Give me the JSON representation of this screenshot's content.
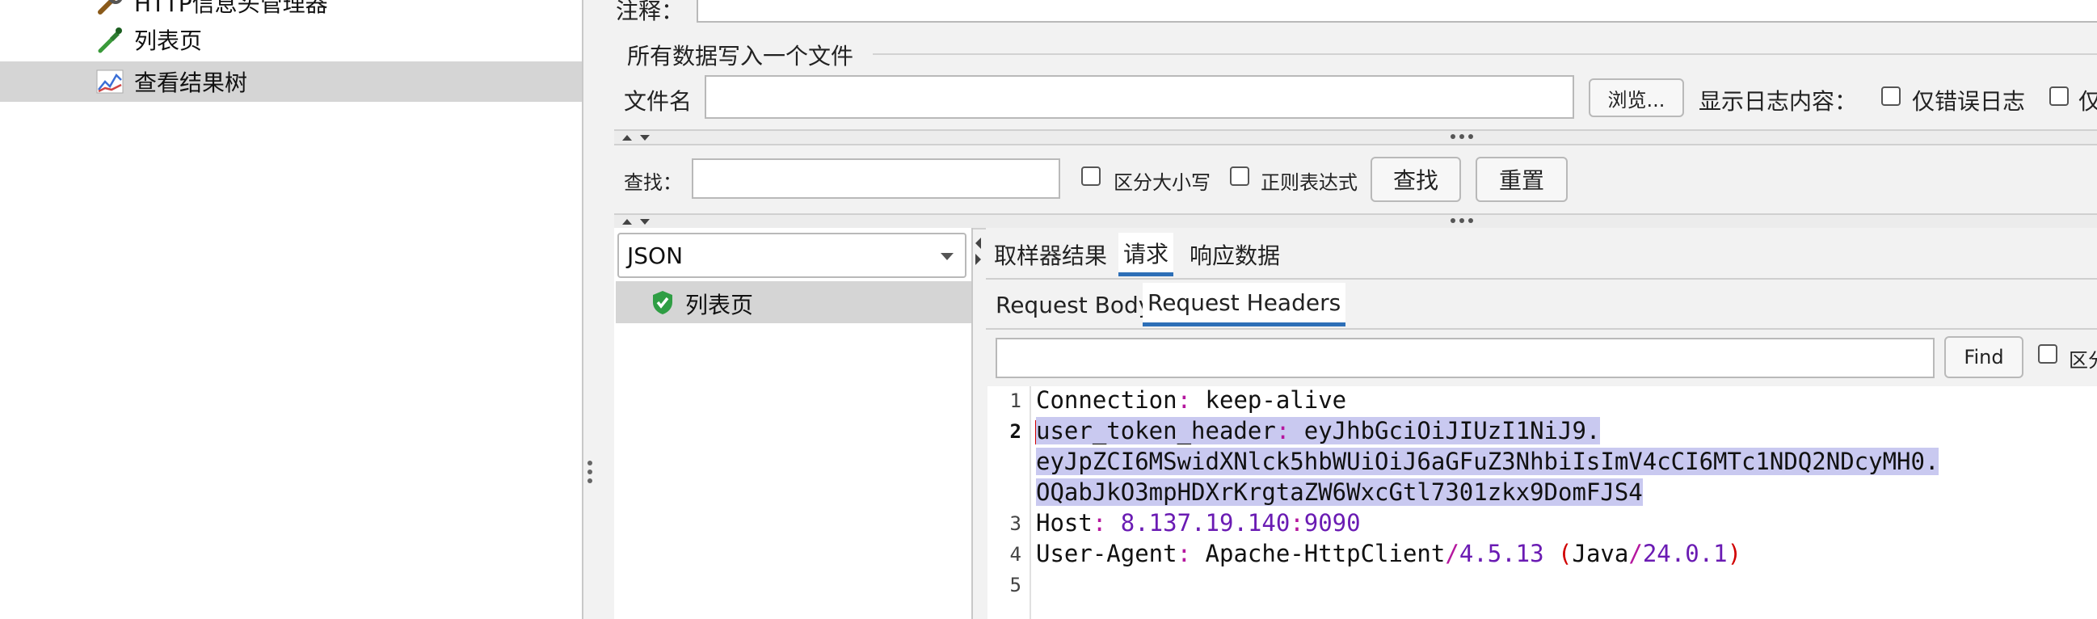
{
  "tree": {
    "items": [
      {
        "label": "HTTP信息头管理器",
        "icon": "wrench-icon"
      },
      {
        "label": "列表页",
        "icon": "pipette-icon"
      },
      {
        "label": "查看结果树",
        "icon": "chart-icon",
        "selected": true
      }
    ]
  },
  "form": {
    "comment_label": "注释：",
    "section_title": "所有数据写入一个文件",
    "filename_label": "文件名",
    "browse_button": "浏览...",
    "log_content_label": "显示日志内容：",
    "errors_only_label": "仅错误日志",
    "success_only_label": "仅"
  },
  "search": {
    "label": "查找：",
    "case_label": "区分大小写",
    "regex_label": "正则表达式",
    "find_button": "查找",
    "reset_button": "重置"
  },
  "results": {
    "renderer_select": "JSON",
    "samples": [
      {
        "label": "列表页",
        "status": "success-shield-icon"
      }
    ]
  },
  "tabs": {
    "main": [
      "取样器结果",
      "请求",
      "响应数据"
    ],
    "main_active": "请求",
    "sub": [
      "Request Body",
      "Request Headers"
    ],
    "sub_active": "Request Headers"
  },
  "find_bar": {
    "find_button": "Find",
    "case_label": "区分"
  },
  "headers_text": {
    "line_numbers": [
      "1",
      "2",
      "3",
      "4",
      "5"
    ],
    "l1_key": "Connection",
    "l1_sep": ": ",
    "l1_val": "keep-alive",
    "l2_key": "user_token_header",
    "l2_sep": ": ",
    "l2_val_a": "eyJhbGciOiJIUzI1NiJ9.",
    "l2_val_b": "eyJpZCI6MSwidXNlck5hbWUiOiJ6aGFuZ3NhbiIsImV4cCI6MTc1NDQ2NDcyMH0.",
    "l2_val_c": "OQabJkO3mpHDXrKrgtaZW6WxcGtl7301zkx9DomFJS4",
    "l3_key": "Host",
    "l3_sep": ": ",
    "l3_host": "8.137.19.140",
    "l3_colon": ":",
    "l3_port": "9090",
    "l4_key": "User-Agent",
    "l4_sep": ": ",
    "l4_a": "Apache-HttpClient",
    "l4_slash1": "/",
    "l4_ver": "4.5.13",
    "l4_open": " (",
    "l4_java": "Java",
    "l4_slash2": "/",
    "l4_jver": "24.0.1",
    "l4_close": ")"
  },
  "colors": {
    "accent": "#2d6fb7",
    "highlight": "#c9c9f0",
    "number": "#6a1bb3",
    "paren": "#d10000"
  }
}
